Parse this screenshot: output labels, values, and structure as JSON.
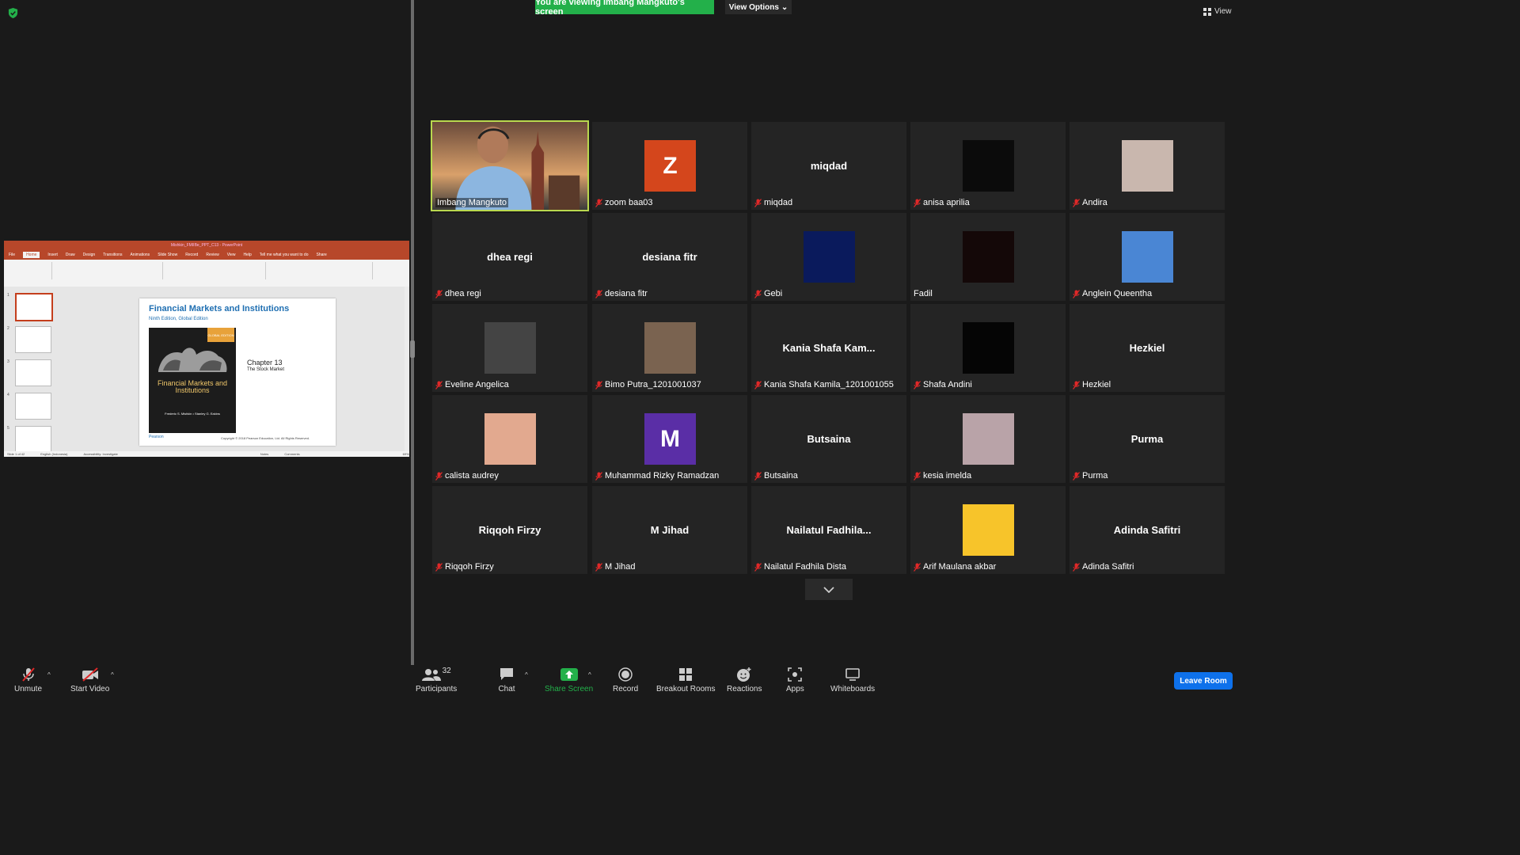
{
  "banner": {
    "viewing": "You are viewing Imbang Mangkuto's screen",
    "view_options": "View Options",
    "view": "View"
  },
  "ppt": {
    "title": "Mishkin_FMIIBe_PPT_C13 - PowerPoint",
    "tabs": [
      "File",
      "Home",
      "Insert",
      "Draw",
      "Design",
      "Transitions",
      "Animations",
      "Slide Show",
      "Record",
      "Review",
      "View",
      "Help",
      "Tell me what you want to do",
      "Share"
    ],
    "slide_title": "Financial Markets and Institutions",
    "slide_edition": "Ninth Edition, Global Edition",
    "book_title": "Financial Markets and Institutions",
    "book_authors": "Frederic S. Mishkin • Stanley G. Eakins",
    "book_badge": "GLOBAL EDITION",
    "chapter": "Chapter 13",
    "chapter_sub": "The Stock Market",
    "copyright": "Copyright © 2018 Pearson Education, Ltd. All Rights Reserved.",
    "publisher": "Pearson",
    "thumb_numbers": [
      "1",
      "2",
      "3",
      "4",
      "5"
    ],
    "status_slide": "Slide 1 of 42",
    "status_lang": "English (Indonesia)",
    "status_access": "Accessibility: Investigate",
    "status_notes": "Notes",
    "status_comments": "Comments",
    "status_zoom": "69%"
  },
  "participants": [
    {
      "label": "Imbang Mangkuto",
      "big": "",
      "avatar": "",
      "color": "",
      "muted": false
    },
    {
      "label": "zoom baa03",
      "big": "",
      "avatar": "Z",
      "color": "#d4461c",
      "muted": true
    },
    {
      "label": "miqdad",
      "big": "miqdad",
      "avatar": "",
      "color": "",
      "muted": true
    },
    {
      "label": "anisa aprilia",
      "big": "",
      "avatar": "",
      "color": "#0b0b0b",
      "muted": true
    },
    {
      "label": "Andira",
      "big": "",
      "avatar": "",
      "color": "#c9b7ae",
      "muted": true
    },
    {
      "label": "dhea regi",
      "big": "dhea regi",
      "avatar": "",
      "color": "",
      "muted": true
    },
    {
      "label": "desiana fitr",
      "big": "desiana fitr",
      "avatar": "",
      "color": "",
      "muted": true
    },
    {
      "label": "Gebi",
      "big": "",
      "avatar": "",
      "color": "#0a1a5c",
      "muted": true
    },
    {
      "label": "Fadil",
      "big": "",
      "avatar": "",
      "color": "#140808",
      "muted": false
    },
    {
      "label": "Anglein Queentha",
      "big": "",
      "avatar": "",
      "color": "#4a86d4",
      "muted": true
    },
    {
      "label": "Eveline Angelica",
      "big": "",
      "avatar": "",
      "color": "#444444",
      "muted": true
    },
    {
      "label": "Bimo Putra_1201001037",
      "big": "",
      "avatar": "",
      "color": "#7a6350",
      "muted": true
    },
    {
      "label": "Kania Shafa Kamila_1201001055",
      "big": "Kania  Shafa  Kam...",
      "avatar": "",
      "color": "",
      "muted": true
    },
    {
      "label": "Shafa Andini",
      "big": "",
      "avatar": "",
      "color": "#050505",
      "muted": true
    },
    {
      "label": "Hezkiel",
      "big": "Hezkiel",
      "avatar": "",
      "color": "",
      "muted": true
    },
    {
      "label": "calista audrey",
      "big": "",
      "avatar": "",
      "color": "#e2a98f",
      "muted": true
    },
    {
      "label": "Muhammad Rizky Ramadzan",
      "big": "",
      "avatar": "M",
      "color": "#5a2ea6",
      "muted": true
    },
    {
      "label": "Butsaina",
      "big": "Butsaina",
      "avatar": "",
      "color": "",
      "muted": true
    },
    {
      "label": "kesia imelda",
      "big": "",
      "avatar": "",
      "color": "#b9a3a8",
      "muted": true
    },
    {
      "label": "Purma",
      "big": "Purma",
      "avatar": "",
      "color": "",
      "muted": true
    },
    {
      "label": "Riqqoh Firzy",
      "big": "Riqqoh Firzy",
      "avatar": "",
      "color": "",
      "muted": true
    },
    {
      "label": "M Jihad",
      "big": "M Jihad",
      "avatar": "",
      "color": "",
      "muted": true
    },
    {
      "label": "Nailatul Fadhila Dista",
      "big": "Nailatul  Fadhila...",
      "avatar": "",
      "color": "",
      "muted": true
    },
    {
      "label": "Arif Maulana akbar",
      "big": "",
      "avatar": "",
      "color": "#f7c42a",
      "muted": true
    },
    {
      "label": "Adinda Safitri",
      "big": "Adinda Safitri",
      "avatar": "",
      "color": "",
      "muted": true
    }
  ],
  "toolbar": {
    "unmute": "Unmute",
    "start_video": "Start Video",
    "participants": "Participants",
    "participants_count": "32",
    "chat": "Chat",
    "share_screen": "Share Screen",
    "record": "Record",
    "breakout_rooms": "Breakout Rooms",
    "reactions": "Reactions",
    "apps": "Apps",
    "whiteboards": "Whiteboards",
    "leave_room": "Leave Room"
  }
}
